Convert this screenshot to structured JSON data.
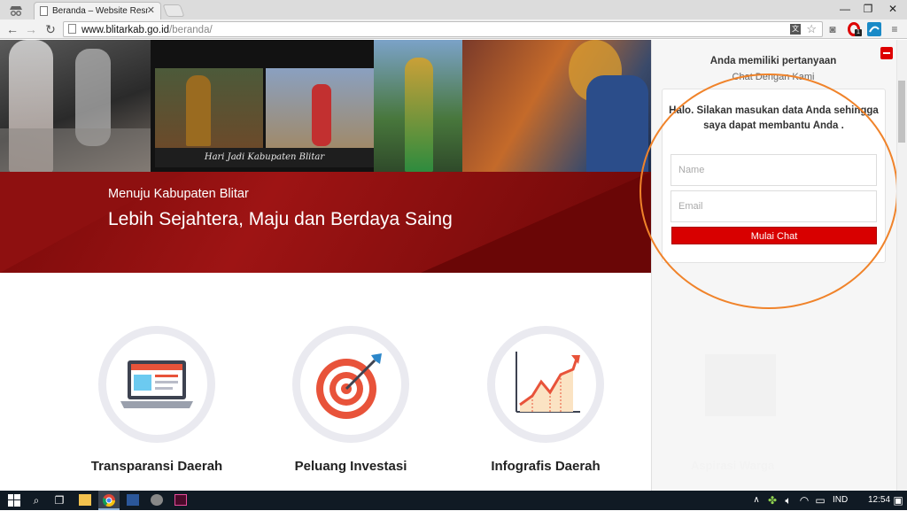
{
  "browser": {
    "tab_title": "Beranda – Website Resmi",
    "url_host": "www.blitarkab.go.id",
    "url_path": "/beranda/",
    "ext_badge": "1"
  },
  "hero": {
    "photo_caption": "Hari Jadi Kabupaten Blitar"
  },
  "banner": {
    "subtitle": "Menuju Kabupaten Blitar",
    "headline": "Lebih Sejahtera, Maju dan Berdaya Saing"
  },
  "features": [
    {
      "label": "Transparansi Daerah",
      "icon": "laptop-icon"
    },
    {
      "label": "Peluang Investasi",
      "icon": "target-icon"
    },
    {
      "label": "Infografis Daerah",
      "icon": "chart-icon"
    }
  ],
  "chat": {
    "question": "Anda memiliki pertanyaan",
    "chat_with": "Chat Dengan Kami",
    "greeting": "Halo. Silakan masukan data Anda sehingga saya dapat membantu Anda .",
    "name_placeholder": "Name",
    "email_placeholder": "Email",
    "start_button": "Mulai Chat",
    "highlight_color": "#f0832a",
    "button_color": "#d80000"
  },
  "sidebar_faded_text": "Aspirasi Warga",
  "taskbar": {
    "lang": "IND",
    "time": "12:54"
  }
}
